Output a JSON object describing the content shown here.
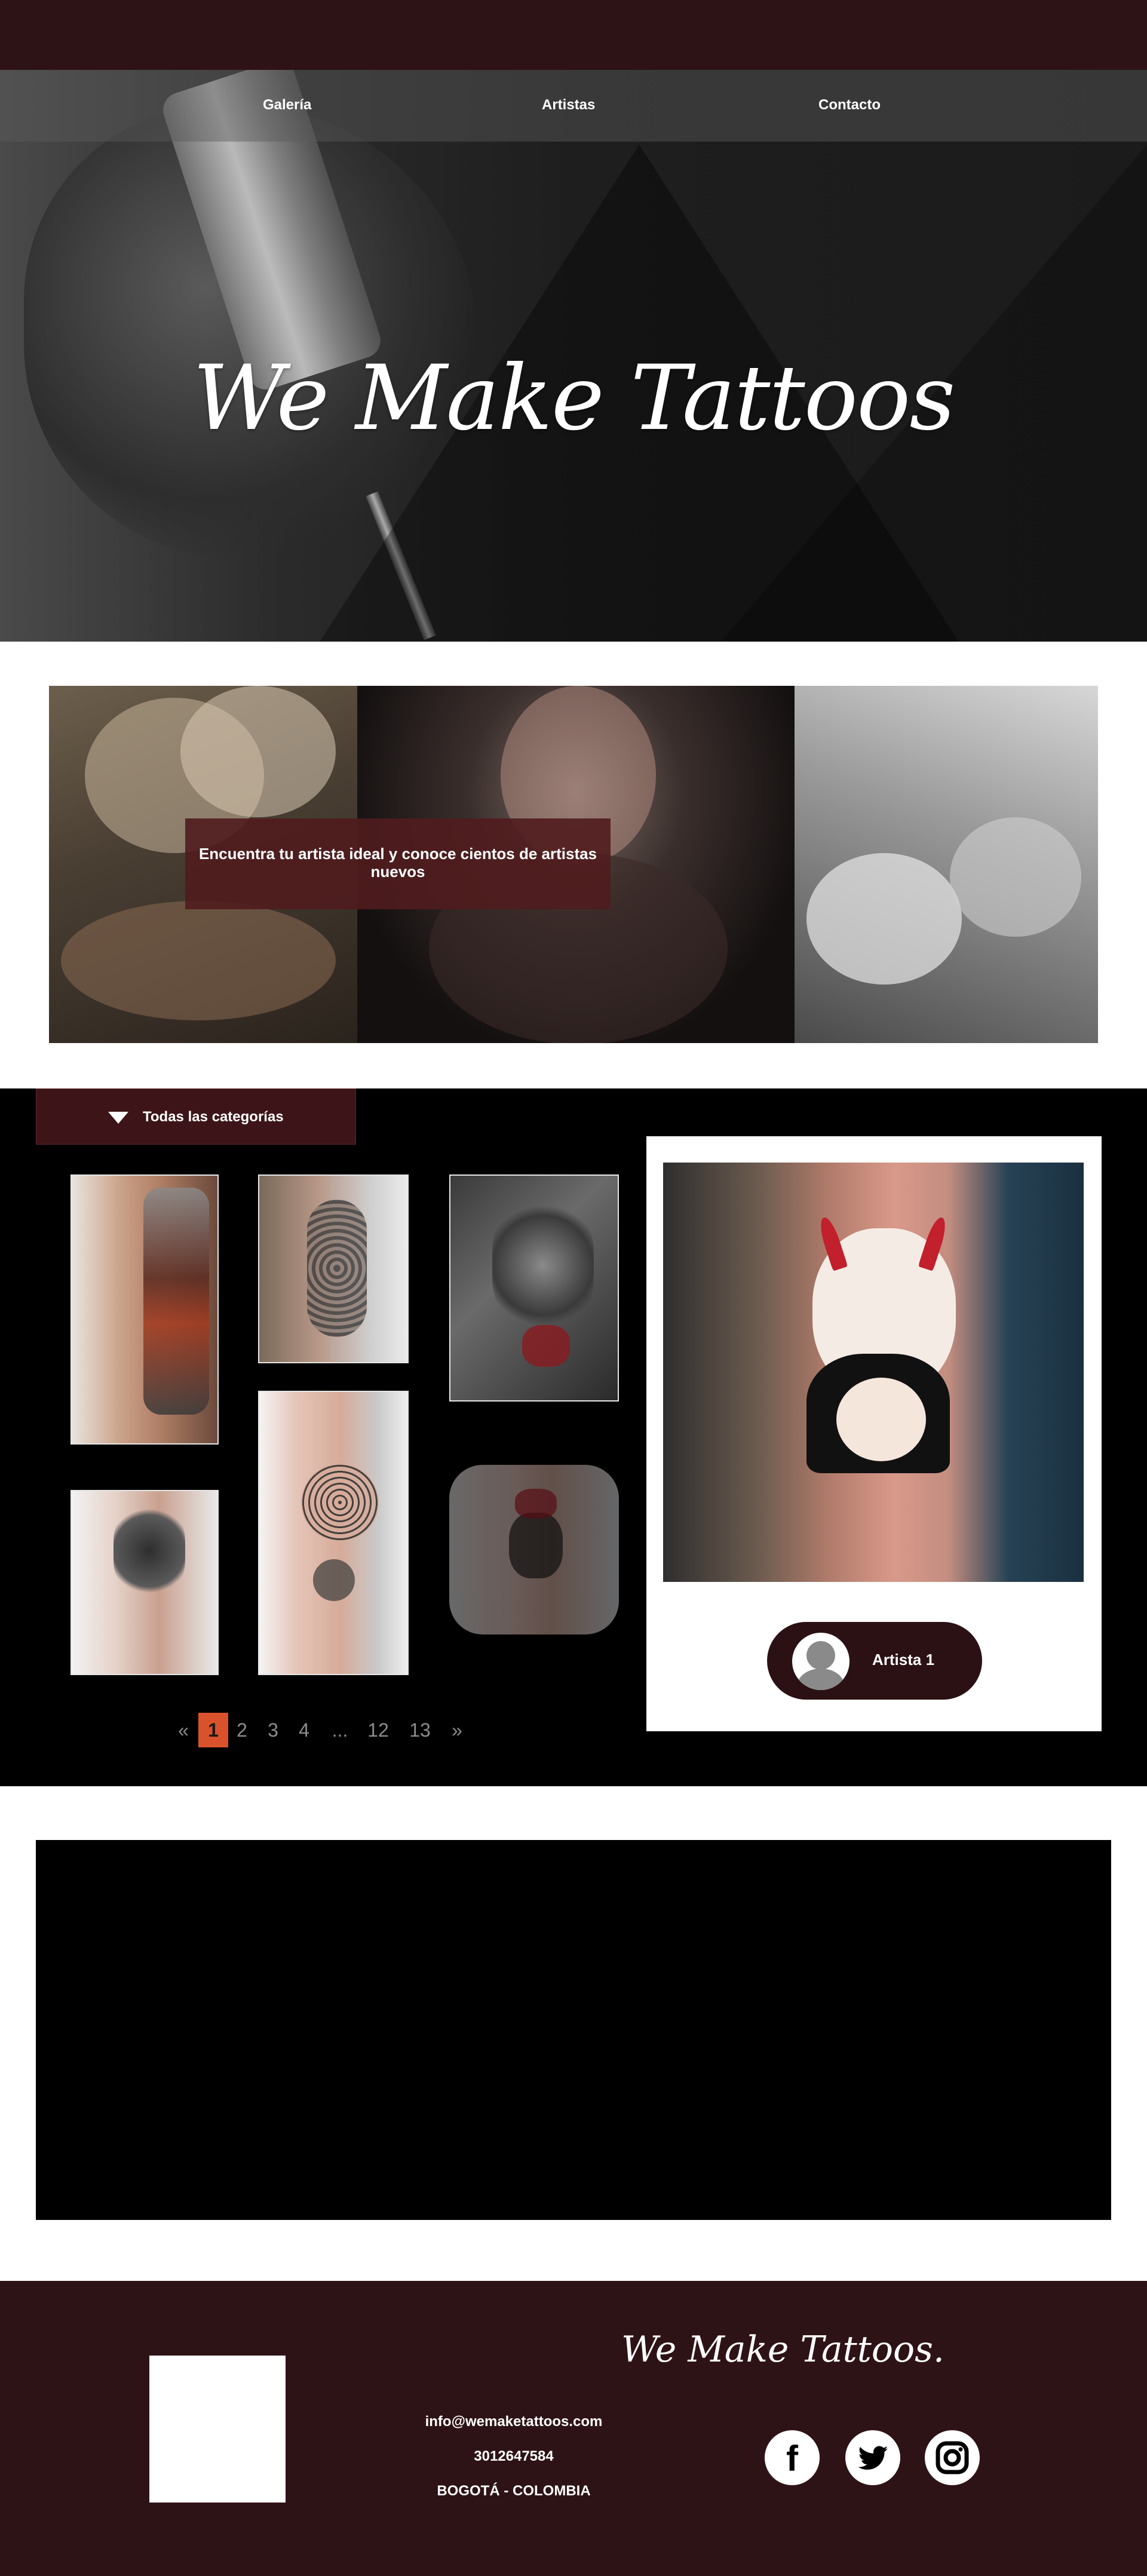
{
  "nav": {
    "items": [
      "Galería",
      "Artistas",
      "Contacto"
    ]
  },
  "hero": {
    "title": "We Make Tattoos"
  },
  "banner": {
    "text": "Encuentra tu artista ideal y conoce cientos de artistas nuevos"
  },
  "gallery": {
    "category_button": "Todas las categorías",
    "pagination": {
      "prev": "«",
      "pages": [
        "1",
        "2",
        "3",
        "4",
        "...",
        "12",
        "13"
      ],
      "next": "»",
      "active": "1"
    }
  },
  "preview": {
    "artist_name": "Artista 1"
  },
  "footer": {
    "logo_script": "We Make Tattoos.",
    "email": "info@wemaketattoos.com",
    "phone": "3012647584",
    "location": "BOGOTÁ - COLOMBIA",
    "social": [
      "facebook-icon",
      "twitter-icon",
      "instagram-icon"
    ]
  },
  "colors": {
    "brand_dark": "#2e1316",
    "accent": "#d9522b",
    "banner_box": "#501c1e"
  }
}
